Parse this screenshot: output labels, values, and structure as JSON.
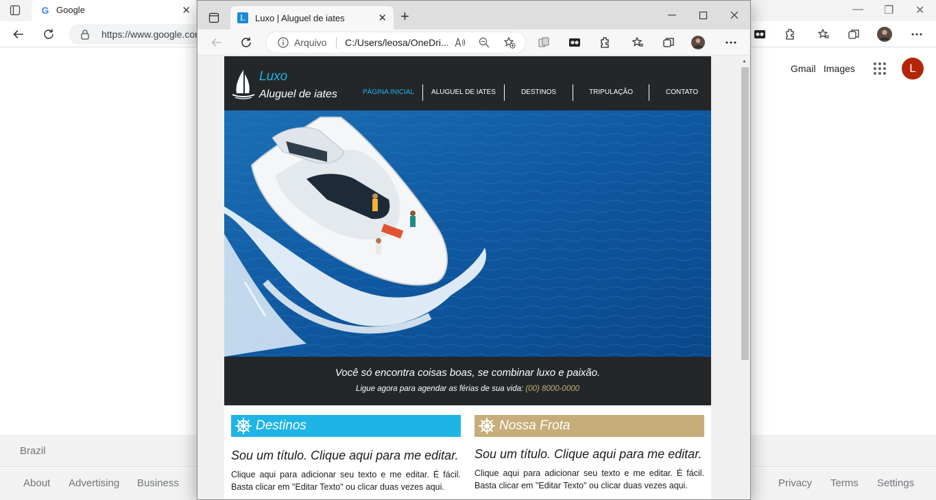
{
  "background_browser": {
    "tab_title": "Google",
    "url": "https://www.google.com",
    "header_links": [
      "Gmail",
      "Images"
    ],
    "avatar_letter": "L",
    "country": "Brazil",
    "footer_left": [
      "About",
      "Advertising",
      "Business"
    ],
    "footer_right": [
      "Privacy",
      "Terms",
      "Settings"
    ]
  },
  "edge": {
    "tab_title": "Luxo | Aluguel de iates",
    "tab_favicon_letter": "L",
    "file_label": "Arquivo",
    "path": "C:/Users/leosa/OneDri..."
  },
  "site": {
    "logo_line1": "Luxo",
    "logo_line2": "Aluguel de iates",
    "nav": [
      "PÁGINA INICIAL",
      "ALUGUEL DE IATES",
      "DESTINOS",
      "TRIPULAÇÃO",
      "CONTATO"
    ],
    "tagline": "Você só encontra coisas boas, se combinar luxo e paixão.",
    "call_text": "Ligue agora para agendar as férias de sua vida: ",
    "call_phone": "(00) 8000-0000",
    "col1": {
      "heading": "Destinos",
      "title": "Sou um título. Clique aqui para me editar.",
      "text": "Clique aqui para adicionar seu texto e me editar. É fácil. Basta clicar em \"Editar Texto\" ou clicar duas vezes aqui."
    },
    "col2": {
      "heading": "Nossa Frota",
      "title": "Sou um título. Clique aqui para me editar.",
      "text": "Clique aqui para adicionar seu texto e me editar. É fácil. Basta clicar em \"Editar Texto\" ou clicar duas vezes aqui."
    }
  },
  "colors": {
    "accent_blue": "#1fb4e6",
    "accent_gold": "#c6ad79",
    "dark_band": "#23272a",
    "sea": "#0f4f8f"
  }
}
